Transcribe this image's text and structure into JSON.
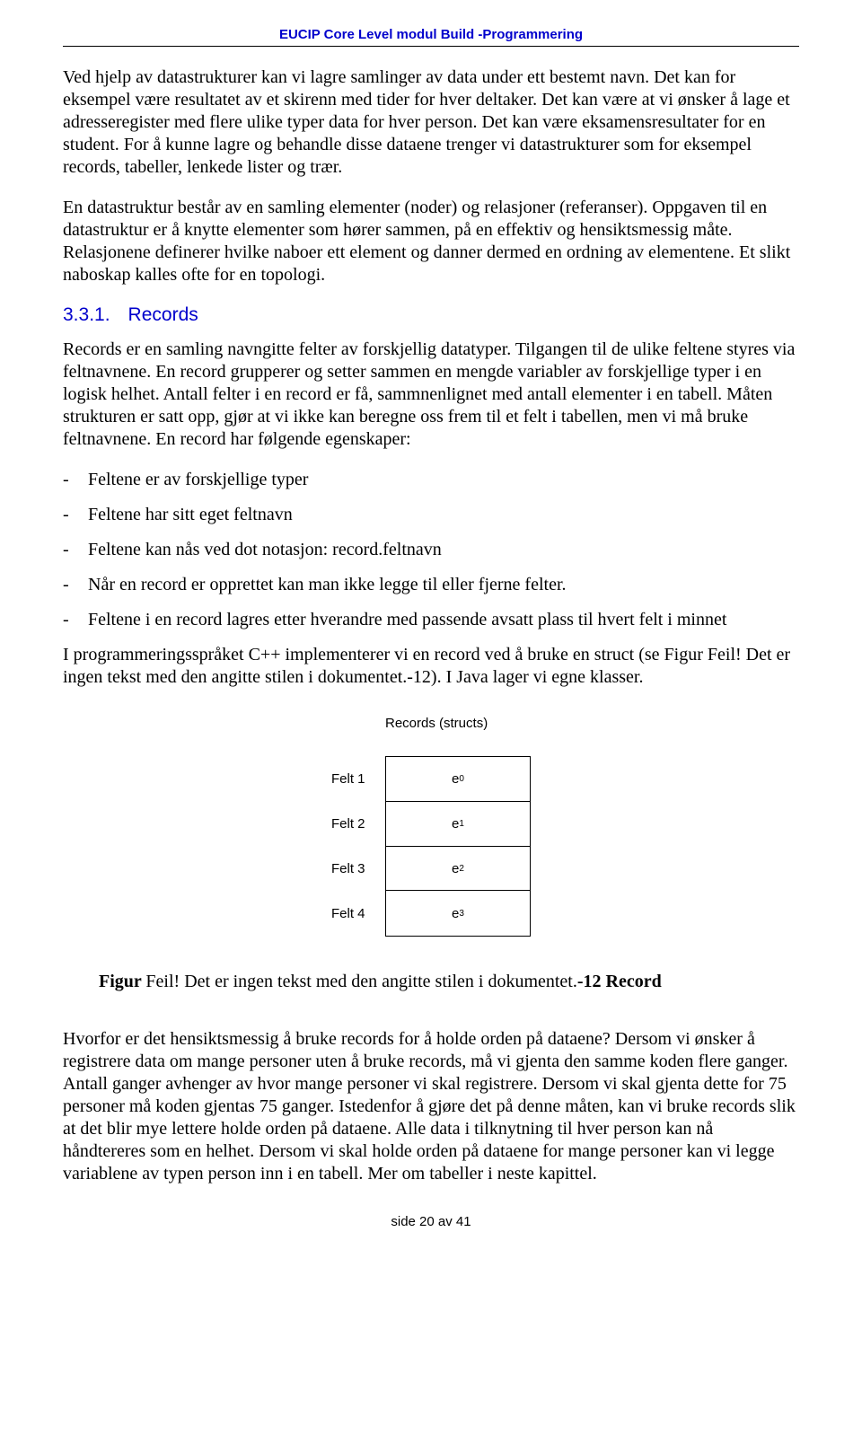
{
  "header": "EUCIP Core Level modul Build -Programmering",
  "para1": "Ved hjelp av datastrukturer kan vi lagre samlinger av data under ett bestemt navn. Det kan for eksempel være resultatet av et skirenn med tider for hver deltaker. Det kan være at vi ønsker å lage et adresseregister med flere ulike typer data for hver person. Det kan være eksamensresultater for en student. For å kunne lagre og behandle disse dataene trenger vi datastrukturer som for eksempel records, tabeller, lenkede lister og trær.",
  "para2": "En datastruktur består av en samling elementer (noder) og relasjoner (referanser). Oppgaven til en datastruktur er å knytte elementer som hører sammen, på en effektiv og hensiktsmessig måte. Relasjonene definerer hvilke naboer ett element og danner dermed en ordning av elementene. Et slikt naboskap kalles ofte for en topologi.",
  "section": {
    "num": "3.3.1.",
    "title": "Records"
  },
  "para3": "Records er en samling navngitte felter av forskjellig datatyper. Tilgangen til de ulike feltene styres via feltnavnene. En record grupperer og setter sammen en mengde variabler av forskjellige typer i en logisk helhet. Antall felter i en record er få, sammnenlignet med antall elementer i en tabell. Måten strukturen er satt opp, gjør at vi ikke kan beregne oss frem til et felt i tabellen, men vi må bruke feltnavnene. En record har følgende egenskaper:",
  "bullets": [
    "Feltene er av forskjellige typer",
    "Feltene har sitt eget feltnavn",
    "Feltene kan nås ved dot notasjon: record.feltnavn",
    "Når en record er opprettet kan man ikke legge til eller fjerne felter.",
    "Feltene i en record lagres etter hverandre med passende avsatt plass til hvert felt i minnet"
  ],
  "para4": "I programmeringsspråket C++ implementerer vi en record ved å bruke en struct (se Figur Feil! Det er ingen tekst med den angitte stilen i dokumentet.-12). I Java lager vi egne klasser.",
  "figure": {
    "title": "Records (structs)",
    "rows": [
      {
        "label": "Felt 1",
        "value_base": "e",
        "value_sub": "0"
      },
      {
        "label": "Felt 2",
        "value_base": "e",
        "value_sub": "1"
      },
      {
        "label": "Felt 3",
        "value_base": "e",
        "value_sub": "2"
      },
      {
        "label": "Felt 4",
        "value_base": "e",
        "value_sub": "3"
      }
    ]
  },
  "caption": {
    "bold1": "Figur ",
    "plain": "Feil! Det er ingen tekst med den angitte stilen i dokumentet.",
    "bold2": "-12 Record"
  },
  "para5": "Hvorfor er det hensiktsmessig å bruke records for å holde orden på dataene? Dersom vi ønsker å registrere data om mange personer uten å bruke records, må vi gjenta den samme koden flere ganger. Antall ganger avhenger av hvor mange personer vi skal registrere. Dersom vi skal gjenta dette for 75 personer må koden gjentas 75 ganger. Istedenfor å gjøre det på denne måten, kan vi bruke records slik at det blir mye lettere holde orden på dataene. Alle data i tilknytning til hver person kan nå håndtereres som en helhet. Dersom vi skal holde orden på dataene for mange personer kan vi legge variablene av typen person inn i en tabell. Mer om tabeller i neste kapittel.",
  "footer": "side 20 av 41"
}
